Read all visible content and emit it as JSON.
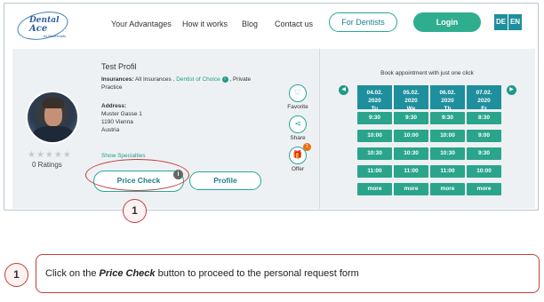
{
  "header": {
    "logo_line1": "Dental",
    "logo_line2": "Ace",
    "logo_line3": "by BestHealth",
    "nav": [
      "Your Advantages",
      "How it works",
      "Blog",
      "Contact us"
    ],
    "for_dentists": "For Dentists",
    "login": "Login",
    "languages": [
      "DE",
      "EN"
    ]
  },
  "profile": {
    "name": "Test Profil",
    "insurances_label": "Insurances:",
    "insurances_pre": "All Insurances ,",
    "insurances_link": "Dentist of Choice",
    "insurances_post": ", Private",
    "insurances_line2": "Practice",
    "address_label": "Address:",
    "address_lines": [
      "Muster Gasse 1",
      "1190 Vienna",
      "Austria"
    ],
    "show_specialties": "Show Specialties",
    "stars": "★★★★★",
    "ratings": "0 Ratings",
    "price_check": "Price Check",
    "profile_button": "Profile",
    "info_mark": "i",
    "favorite": "Favorite",
    "share": "Share",
    "offer": "Offer",
    "offer_badge": "1"
  },
  "booking": {
    "title": "Book appointment with just one click",
    "days": [
      {
        "date": "04.02.",
        "year": "2020",
        "weekday": "Tu",
        "slots": [
          "9:30",
          "10:00",
          "10:30",
          "11:00",
          "more"
        ]
      },
      {
        "date": "05.02.",
        "year": "2020",
        "weekday": "We",
        "slots": [
          "9:30",
          "10:00",
          "10:30",
          "11:00",
          "more"
        ]
      },
      {
        "date": "06.02.",
        "year": "2020",
        "weekday": "Th",
        "slots": [
          "9:30",
          "10:00",
          "10:30",
          "11:00",
          "more"
        ]
      },
      {
        "date": "07.02.",
        "year": "2020",
        "weekday": "Fr",
        "slots": [
          "8:30",
          "9:00",
          "9:30",
          "10:00",
          "more"
        ]
      }
    ]
  },
  "callout": {
    "number": "1",
    "text_pre": "Click on the ",
    "text_bold": "Price Check",
    "text_post": " button to proceed to the personal request form"
  },
  "colors": {
    "accent": "#27a79a",
    "slot": "#2aa58c",
    "day": "#1e8f9c",
    "callout": "#c43d3d"
  }
}
